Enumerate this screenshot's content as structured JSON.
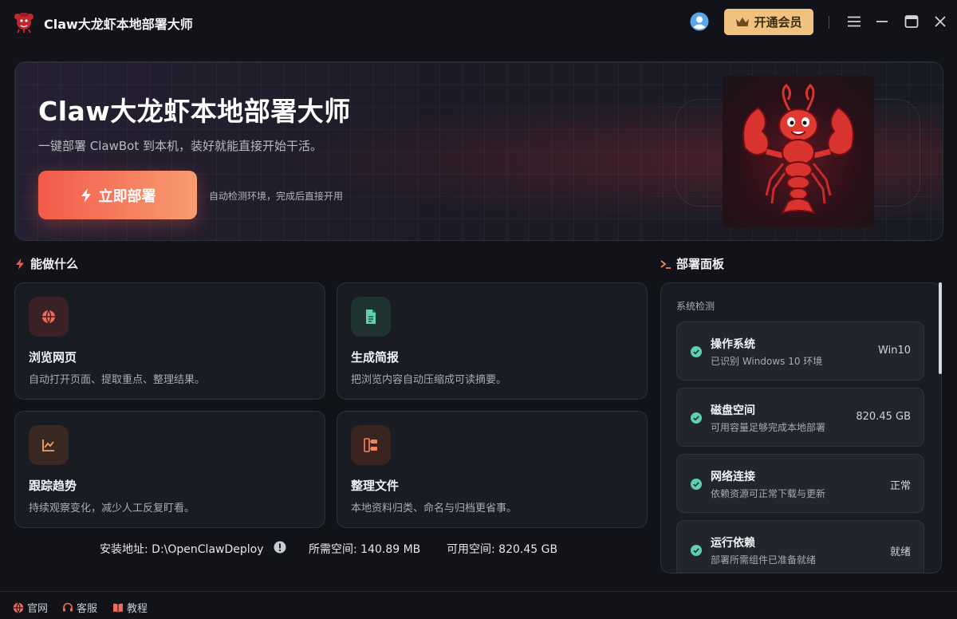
{
  "app": {
    "title": "Claw大龙虾本地部署大师"
  },
  "header": {
    "vip_label": "开通会员"
  },
  "hero": {
    "title": "Claw大龙虾本地部署大师",
    "subtitle": "一键部署 ClawBot 到本机，装好就能直接开始干活。",
    "deploy_label": "立即部署",
    "hint": "自动检测环境，完成后直接开用"
  },
  "features": {
    "heading": "能做什么",
    "items": [
      {
        "title": "浏览网页",
        "desc": "自动打开页面、提取重点、整理结果。",
        "icon": "globe-icon",
        "color": "#f26a5a"
      },
      {
        "title": "生成简报",
        "desc": "把浏览内容自动压缩成可读摘要。",
        "icon": "document-icon",
        "color": "#5fcfb0"
      },
      {
        "title": "跟踪趋势",
        "desc": "持续观察变化，减少人工反复盯看。",
        "icon": "trend-chart-icon",
        "color": "#f2a06a"
      },
      {
        "title": "整理文件",
        "desc": "本地资料归类、命名与归档更省事。",
        "icon": "folder-tree-icon",
        "color": "#f2835e"
      }
    ]
  },
  "install": {
    "path_label": "安装地址: D:\\OpenClawDeploy",
    "required_label": "所需空间: 140.89 MB",
    "available_label": "可用空间: 820.45 GB"
  },
  "panel": {
    "heading": "部署面板",
    "section_label": "系统检测",
    "checks": [
      {
        "title": "操作系统",
        "desc": "已识别 Windows 10 环境",
        "value": "Win10"
      },
      {
        "title": "磁盘空间",
        "desc": "可用容量足够完成本地部署",
        "value": "820.45 GB"
      },
      {
        "title": "网络连接",
        "desc": "依赖资源可正常下载与更新",
        "value": "正常"
      },
      {
        "title": "运行依赖",
        "desc": "部署所需组件已准备就绪",
        "value": "就绪"
      }
    ]
  },
  "footer": {
    "links": [
      {
        "label": "官网",
        "icon": "globe-icon"
      },
      {
        "label": "客服",
        "icon": "headset-icon"
      },
      {
        "label": "教程",
        "icon": "book-icon"
      }
    ]
  },
  "colors": {
    "accent": "#f25a49",
    "vip": "#f1c27d",
    "ok": "#5fcfb0"
  }
}
